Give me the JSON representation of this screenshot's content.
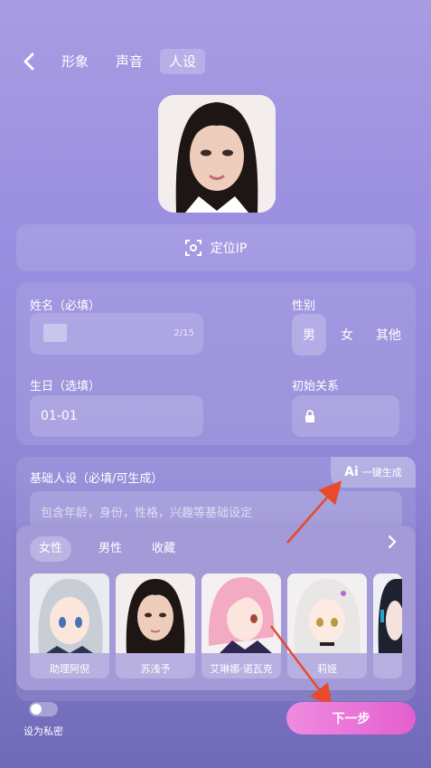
{
  "header": {
    "tabs": [
      {
        "label": "形象",
        "active": false
      },
      {
        "label": "声音",
        "active": false
      },
      {
        "label": "人设",
        "active": true
      }
    ]
  },
  "locate": {
    "label": "定位IP"
  },
  "form": {
    "name_label": "姓名（必填）",
    "name_count": "2/15",
    "gender_label": "性别",
    "gender_options": [
      "男",
      "女",
      "其他"
    ],
    "gender_selected": "男",
    "birthday_label": "生日（选填）",
    "birthday_value": "01-01",
    "relation_label": "初始关系"
  },
  "persona": {
    "label": "基础人设（必填/可生成）",
    "ai_button": "一键生成",
    "ai_logo": "Ai",
    "placeholder": "包含年龄，身份，性格，兴趣等基础设定"
  },
  "characters": {
    "subtabs": [
      {
        "label": "女性",
        "active": true
      },
      {
        "label": "男性",
        "active": false
      },
      {
        "label": "收藏",
        "active": false
      }
    ],
    "items": [
      {
        "name": "助理阿倪"
      },
      {
        "name": "苏浅予"
      },
      {
        "name": "艾琳娜·诺瓦克"
      },
      {
        "name": "莉娅"
      },
      {
        "name": ""
      }
    ]
  },
  "footer": {
    "private_label": "设为私密",
    "next_label": "下一步"
  },
  "colors": {
    "next_button": "#e35fcf",
    "arrow_annotation": "#e84a2c"
  }
}
